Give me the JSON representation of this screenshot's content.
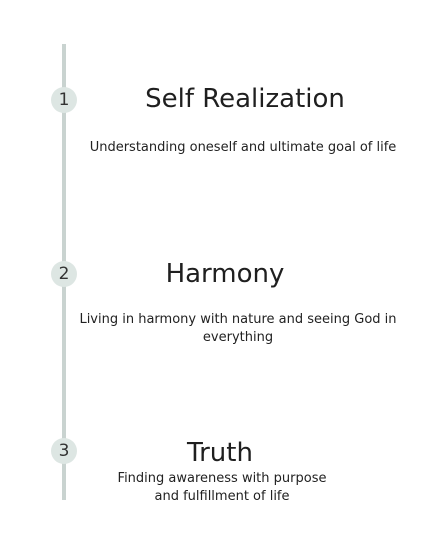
{
  "steps": [
    {
      "number": "1",
      "title": "Self Realization",
      "description": "Understanding oneself and ultimate goal of life"
    },
    {
      "number": "2",
      "title": "Harmony",
      "description": "Living in harmony with nature and seeing God in everything"
    },
    {
      "number": "3",
      "title": "Truth",
      "description": "Finding awareness with purpose and fulfillment of life"
    }
  ],
  "colors": {
    "line": "#c9d3d0",
    "marker": "#dde6e3",
    "text": "#222222"
  }
}
